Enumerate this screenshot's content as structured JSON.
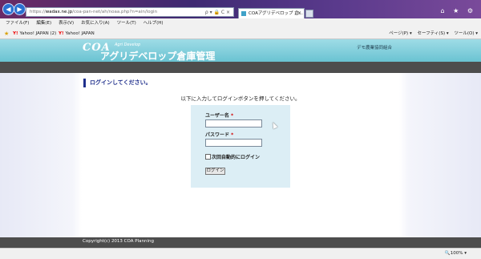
{
  "browser": {
    "url_prefix": "https://",
    "url_domain": "wadax.ne.jp",
    "url_path": "/coa-pan-net/ah/noaa.php?n=ain/login",
    "tab_title": "COAアグリデベロップ 倉...",
    "tab_close": "×",
    "address_tools": "ρ ▾ 🔒 C ×",
    "window_controls": "⌂ ★ ⚙",
    "back": "◀",
    "forward": "▶"
  },
  "menubar": [
    "ファイル(F)",
    "編集(E)",
    "表示(V)",
    "お気に入り(A)",
    "ツール(T)",
    "ヘルプ(H)"
  ],
  "favorites": {
    "star": "★",
    "yahoo_mark": "Y!",
    "items": [
      "Yahoo! JAPAN (2)",
      "Yahoo! JAPAN"
    ]
  },
  "command_bar": [
    "ページ(P) ▾",
    "セーフティ(S) ▾",
    "ツール(O) ▾"
  ],
  "site": {
    "logo_coa": "COA",
    "logo_sub": "Agri Develop",
    "logo_main": "アグリデベロップ倉庫管理",
    "org_name": "デモ農業協同組合"
  },
  "login": {
    "heading": "ログインしてください。",
    "instruction": "以下に入力してログインボタンを押してください。",
    "username_label": "ユーザー名",
    "password_label": "パスワード",
    "required_mark": "*",
    "username_value": "",
    "password_value": "",
    "remember_label": "次回自動的にログイン",
    "remember_checked": false,
    "submit_label": "ログイン"
  },
  "footer": {
    "copyright": "Copyright(c) 2013 COA Planning"
  },
  "status": {
    "zoom": "🔍100% ▾"
  },
  "colors": {
    "title_purple": "#5a2a7a",
    "banner_teal": "#4fb6c8",
    "heading_navy": "#1f2f8c",
    "login_box": "#dceef5",
    "dark_bar": "#4d4d4d",
    "required_red": "#d00000"
  }
}
